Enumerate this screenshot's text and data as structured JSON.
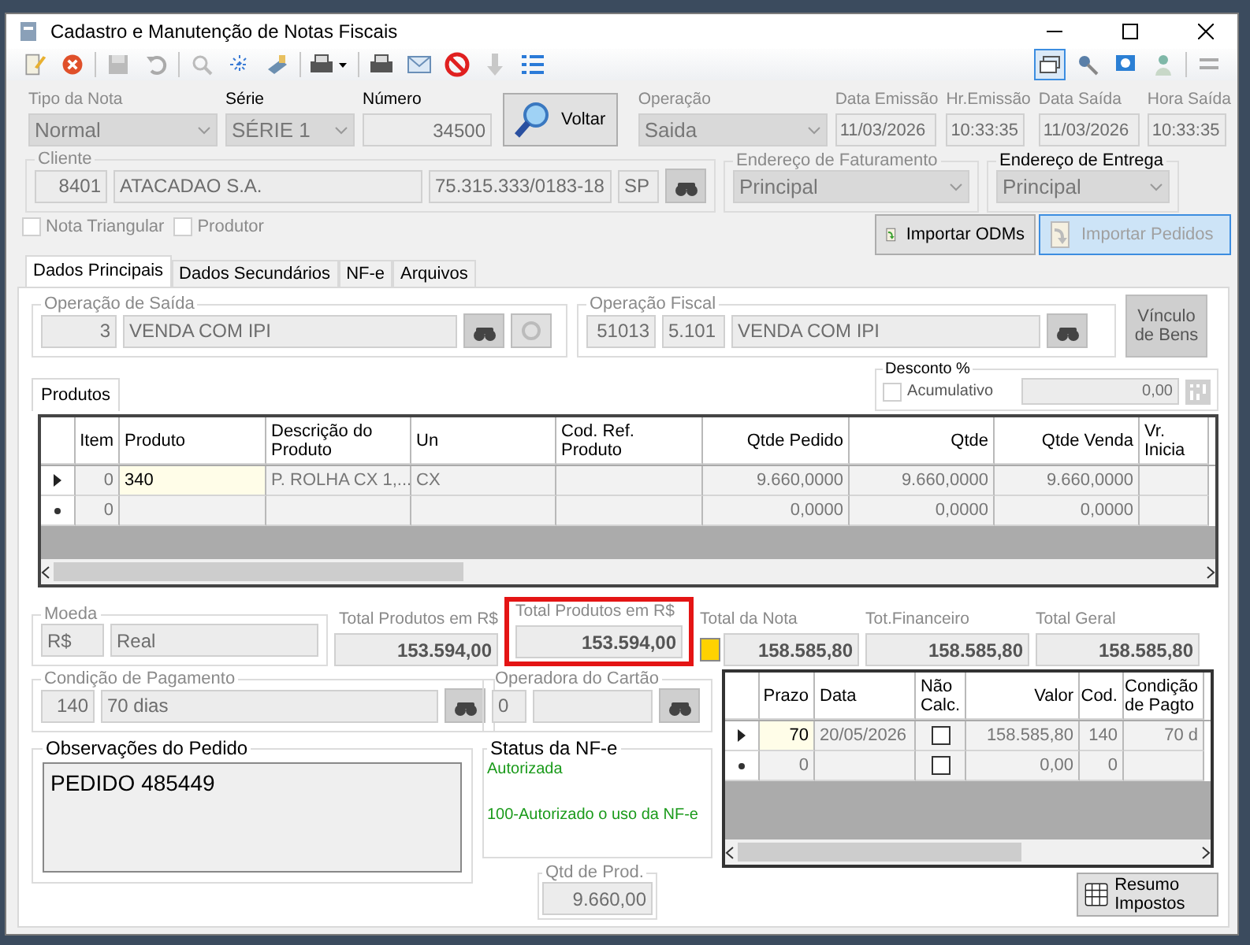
{
  "window": {
    "title": "Cadastro e Manutenção de Notas Fiscais"
  },
  "header": {
    "tipo_nota": {
      "label": "Tipo da Nota",
      "value": "Normal"
    },
    "serie": {
      "label": "Série",
      "value": "SÉRIE 1"
    },
    "numero": {
      "label": "Número",
      "value": "34500"
    },
    "voltar": "Voltar",
    "operacao": {
      "label": "Operação",
      "value": "Saida"
    },
    "dates": [
      {
        "label": "Data Emissão",
        "value": "11/03/2026"
      },
      {
        "label": "Hr.Emissão",
        "value": "10:33:35"
      },
      {
        "label": "Data Saída",
        "value": "11/03/2026"
      },
      {
        "label": "Hora Saída",
        "value": "10:33:35"
      }
    ]
  },
  "cliente": {
    "label": "Cliente",
    "code": "8401",
    "name": "ATACADAO S.A.",
    "cnpj": "75.315.333/0183-18",
    "uf": "SP"
  },
  "endereco_faturamento": {
    "label": "Endereço de Faturamento",
    "value": "Principal"
  },
  "endereco_entrega": {
    "label": "Endereço de Entrega",
    "value": "Principal"
  },
  "options": [
    {
      "label": "Nota Triangular",
      "checked": false
    },
    {
      "label": "Produtor",
      "checked": false
    }
  ],
  "import_buttons": [
    {
      "label": "Importar ODMs",
      "disabled": false
    },
    {
      "label": "Importar Pedidos",
      "disabled": true
    }
  ],
  "tabs": [
    {
      "label": "Dados Principais",
      "selected": true
    },
    {
      "label": "Dados Secundários",
      "selected": false
    },
    {
      "label": "NF-e",
      "selected": false
    },
    {
      "label": "Arquivos",
      "selected": false
    }
  ],
  "operacao_saida": {
    "label": "Operação de Saída",
    "code": "3",
    "name": "VENDA COM IPI"
  },
  "operacao_fiscal": {
    "label": "Operação Fiscal",
    "code": "51013",
    "cfop": "5.101",
    "name": "VENDA COM IPI"
  },
  "vinculo_button": "Vínculo de Bens",
  "produtos_tab": "Produtos",
  "desconto": {
    "label": "Desconto %",
    "option": "Acumulativo",
    "checked": false,
    "value": "0,00"
  },
  "produtos": {
    "columns": [
      {
        "label": "Item"
      },
      {
        "label": "Produto"
      },
      {
        "label": "Descrição do Produto"
      },
      {
        "label": "Un"
      },
      {
        "label": "Cod. Ref. Produto"
      },
      {
        "label": "Qtde Pedido"
      },
      {
        "label": "Qtde"
      },
      {
        "label": "Qtde Venda"
      },
      {
        "label": "Vr. Inicia"
      }
    ],
    "rows": [
      {
        "kind": "current",
        "cells": [
          "0",
          "340",
          "P. ROLHA CX 1,...",
          "CX",
          null,
          "9.660,0000",
          "9.660,0000",
          "9.660,0000",
          null
        ]
      },
      {
        "kind": "new",
        "cells": [
          "0",
          null,
          null,
          null,
          null,
          "0,0000",
          "0,0000",
          "0,0000",
          null
        ]
      }
    ]
  },
  "moeda": {
    "label": "Moeda",
    "code": "R$",
    "name": "Real"
  },
  "totals": [
    {
      "label": "Total Produtos em R$",
      "value": "153.594,00"
    },
    {
      "label": "Total Produtos em R$",
      "value": "153.594,00"
    },
    {
      "label": "Total da Nota",
      "value": "158.585,80"
    },
    {
      "label": "Tot.Financeiro",
      "value": "158.585,80"
    },
    {
      "label": "Total Geral",
      "value": "158.585,80"
    }
  ],
  "condicao_pagamento": {
    "label": "Condição de Pagamento",
    "code": "140",
    "name": "70 dias"
  },
  "operadora_cartao": {
    "label": "Operadora do Cartão",
    "code": "0"
  },
  "observacoes": {
    "label": "Observações do Pedido",
    "text": "PEDIDO 485449"
  },
  "status_nfe": {
    "label": "Status da NF-e",
    "status": "Autorizada",
    "message": "100-Autorizado o uso da NF-e"
  },
  "qtd_prod": {
    "label": "Qtd de Prod.",
    "value": "9.660,00"
  },
  "parcelas": {
    "columns": [
      {
        "label": "Prazo",
        "kind": "text"
      },
      {
        "label": "Data",
        "kind": "text"
      },
      {
        "label": "Não Calc.",
        "kind": "check"
      },
      {
        "label": "Valor",
        "kind": "text"
      },
      {
        "label": "Cod.",
        "kind": "text"
      },
      {
        "label": "Condição de Pagto",
        "kind": "text"
      }
    ],
    "rows": [
      {
        "kind": "current",
        "cells": [
          "70",
          "20/05/2026",
          false,
          "158.585,80",
          "140",
          "70 d"
        ]
      },
      {
        "kind": "new",
        "cells": [
          "0",
          null,
          false,
          "0,00",
          "0",
          null
        ]
      }
    ]
  },
  "resumo_button": "Resumo Impostos"
}
